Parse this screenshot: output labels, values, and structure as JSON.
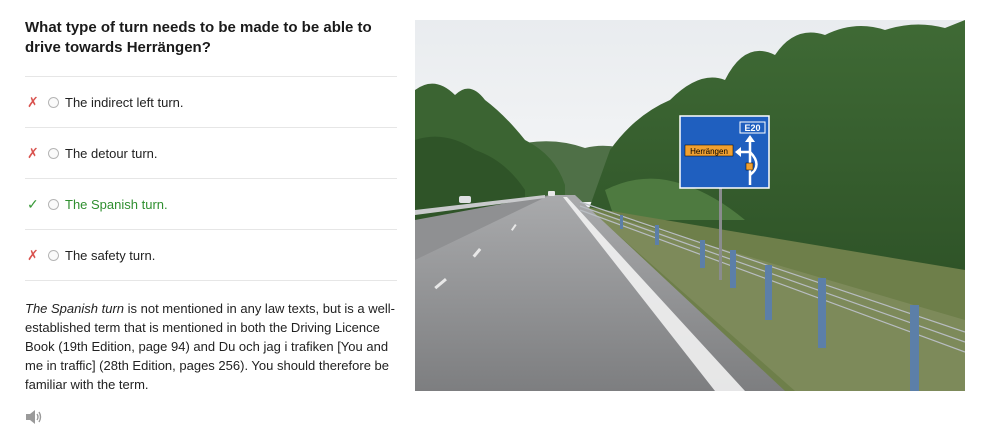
{
  "question": {
    "text": "What type of turn needs to be made to be able to drive towards Herrängen?"
  },
  "options": [
    {
      "label": "The indirect left turn.",
      "status": "incorrect",
      "status_glyph": "✗"
    },
    {
      "label": "The detour turn.",
      "status": "incorrect",
      "status_glyph": "✗"
    },
    {
      "label": "The Spanish turn.",
      "status": "correct",
      "status_glyph": "✓"
    },
    {
      "label": "The safety turn.",
      "status": "incorrect",
      "status_glyph": "✗"
    }
  ],
  "explanation": {
    "term": "The Spanish turn",
    "text": " is not mentioned in any law texts, but is a well-established term that is mentioned in both the Driving Licence Book (19th Edition, page 94) and Du och jag i trafiken [You and me in traffic] (28th Edition, pages 256). You should therefore be familiar with the term."
  },
  "audio": {
    "icon": "speaker-icon"
  },
  "image": {
    "sign_route": "E20",
    "sign_destination": "Herrängen"
  },
  "colors": {
    "correct": "#2f8f2f",
    "incorrect": "#d9534f",
    "sign_blue": "#1f5fbf"
  }
}
